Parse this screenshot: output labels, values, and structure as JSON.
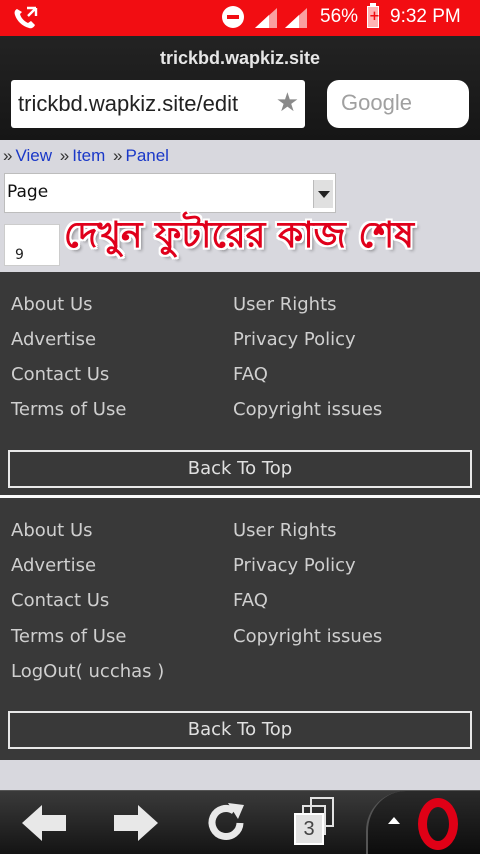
{
  "status_bar": {
    "battery_percent": "56%",
    "time": "9:32 PM",
    "icons": [
      "phone-icon",
      "do-not-disturb-icon",
      "signal-icon",
      "signal-icon",
      "battery-charging-icon"
    ]
  },
  "browser": {
    "page_title": "trickbd.wapkiz.site",
    "address": "trickbd.wapkiz.site/edit",
    "search_placeholder": "Google"
  },
  "breadcrumbs": {
    "sep": "»",
    "items": [
      "View",
      "Item",
      "Panel"
    ]
  },
  "form": {
    "select_value": "Page",
    "small_field_value": "9"
  },
  "banner_text": "দেখুন ফুটারের কাজ শেষ",
  "footer_1": {
    "left_links": [
      "About Us",
      "Advertise",
      "Contact Us",
      "Terms of Use"
    ],
    "right_links": [
      "User Rights",
      "Privacy Policy",
      "FAQ",
      "Copyright issues"
    ],
    "back_to_top": "Back To Top"
  },
  "footer_2": {
    "left_links": [
      "About Us",
      "Advertise",
      "Contact Us",
      "Terms of Use",
      "LogOut( ucchas )"
    ],
    "right_links": [
      "User Rights",
      "Privacy Policy",
      "FAQ",
      "Copyright issues"
    ],
    "back_to_top": "Back To Top"
  },
  "toolbar": {
    "tab_count": "3"
  },
  "colors": {
    "status_bar": "#f20d12",
    "link_blue": "#1a38c8",
    "footer_bg": "#393939",
    "banner_red": "#e0001b",
    "opera_red": "#e00016"
  }
}
